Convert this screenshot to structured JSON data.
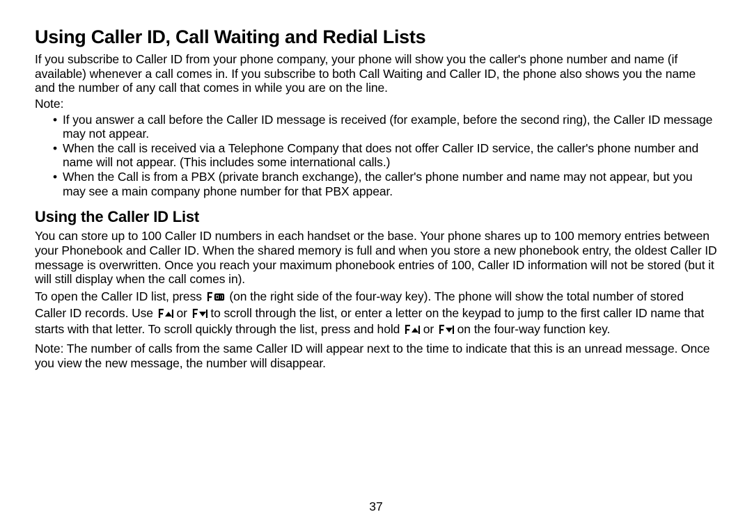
{
  "mainHeading": "Using Caller ID, Call Waiting and Redial Lists",
  "intro": "If you subscribe to Caller ID from your phone company, your phone will show you the caller's phone number and name (if available) whenever a call comes in. If you subscribe to both Call Waiting and Caller ID, the phone also shows you the name and the number of any call that comes in while you are on the line.",
  "noteLabel": "Note:",
  "notes": {
    "item1": "If you answer a call before the Caller ID message is received (for example, before the second ring), the Caller ID message may not appear.",
    "item2": "When the call is received via a Telephone Company that does not offer Caller ID service, the caller's phone number and name will not appear. (This includes some international calls.)",
    "item3": "When the Call is from a PBX (private branch exchange), the caller's phone number and name may not appear, but you may see a main company phone number for that PBX appear."
  },
  "subHeading": "Using the Caller ID List",
  "para1": "You can store up to 100 Caller ID numbers in each handset or the base. Your phone shares up to 100 memory entries between your Phonebook and Caller ID. When the shared memory is full and when you store a new phonebook entry, the oldest Caller ID message is overwritten. Once you reach your maximum phonebook entries of 100, Caller ID information will not be stored (but it will still display when the call comes in).",
  "para2": {
    "seg1": "To open the Caller ID list, press ",
    "seg2": " (on the right side of the four-way key). The phone will show the total number of stored Caller ID records. Use ",
    "seg3": " or ",
    "seg4": " to scroll through the list, or enter a letter on the keypad to jump to the first caller ID name that starts with that letter. To scroll quickly through the list, press and hold ",
    "seg5": " or ",
    "seg6": " on the four-way function key."
  },
  "para3": "Note: The number of calls from the same Caller ID will appear next to the time to indicate that this is an unread message. Once you view the new message, the number will disappear.",
  "pageNumber": "37"
}
